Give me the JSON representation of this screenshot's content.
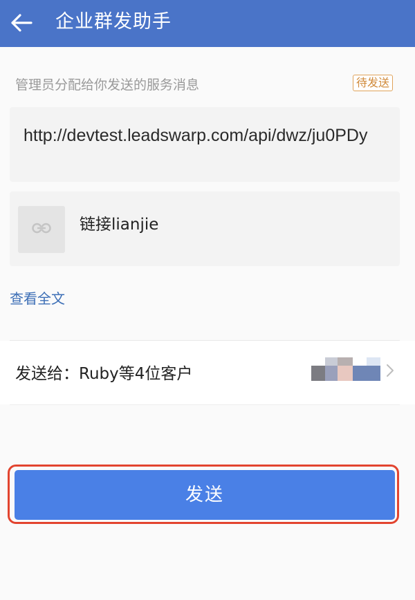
{
  "header": {
    "title": "企业群发助手",
    "back_icon": "arrow-left-icon"
  },
  "message": {
    "label": "管理员分配给你发送的服务消息",
    "status": "待发送",
    "url_text": "http://devtest.leadswarp.com/api/dwz/ju0PDy",
    "link": {
      "icon": "link-icon",
      "title": "链接lianjie"
    },
    "view_full": "查看全文"
  },
  "recipients": {
    "label": "发送给：Ruby等4位客户",
    "chevron_icon": "chevron-right-icon"
  },
  "send_button": {
    "label": "发送"
  },
  "colors": {
    "header_bg": "#4a74c8",
    "accent_blue": "#4a80e6",
    "link_blue": "#3d6fb6",
    "status_orange": "#d08a3a",
    "highlight_red": "#e2442f"
  }
}
